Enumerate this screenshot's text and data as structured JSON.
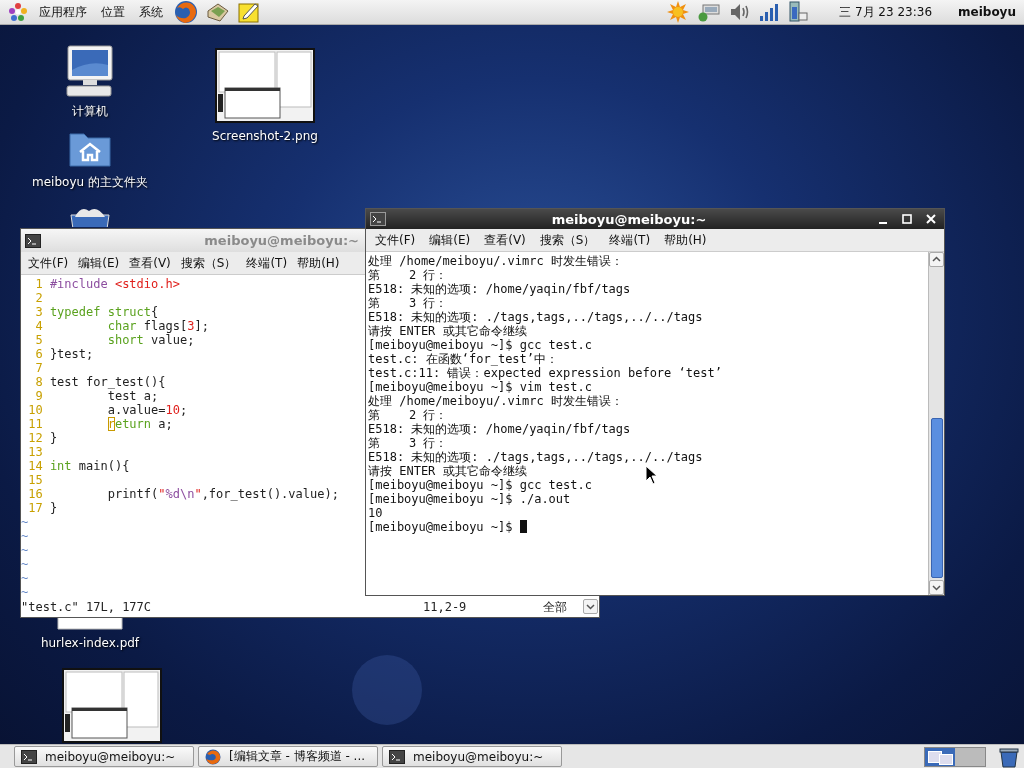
{
  "top_panel": {
    "menus": [
      "应用程序",
      "位置",
      "系统"
    ],
    "clock": "三 7月 23 23:36",
    "user": "meiboyu"
  },
  "desktop_icons": [
    {
      "kind": "computer",
      "label": "计算机"
    },
    {
      "kind": "home-folder",
      "label": "meiboyu 的主文件夹"
    },
    {
      "kind": "trash"
    },
    {
      "kind": "image",
      "label": "Screenshot-2.png"
    },
    {
      "kind": "pdf",
      "label": "hurlex-index.pdf"
    },
    {
      "kind": "image"
    }
  ],
  "editor_window": {
    "title": "meiboyu@meiboyu:~",
    "menus": [
      "文件(F)",
      "编辑(E)",
      "查看(V)",
      "搜索（S）",
      "终端(T)",
      "帮助(H)"
    ],
    "lines": [
      {
        "number": "1",
        "segments": [
          {
            "text": "#include ",
            "kind": "preproc"
          },
          {
            "text": "<stdio.h>",
            "kind": "string"
          }
        ]
      },
      {
        "number": "2"
      },
      {
        "number": "3",
        "segments": [
          {
            "text": "typedef struct",
            "kind": "type"
          },
          {
            "text": "{",
            "kind": "plain"
          }
        ]
      },
      {
        "number": "4",
        "indented": true,
        "segments": [
          {
            "text": "char",
            "kind": "type"
          },
          {
            "text": " flags[",
            "kind": "plain"
          },
          {
            "text": "3",
            "kind": "number"
          },
          {
            "text": "];",
            "kind": "plain"
          }
        ]
      },
      {
        "number": "5",
        "indented": true,
        "segments": [
          {
            "text": "short",
            "kind": "type"
          },
          {
            "text": " value;",
            "kind": "plain"
          }
        ]
      },
      {
        "number": "6",
        "segments": [
          {
            "text": "}test;",
            "kind": "plain"
          }
        ]
      },
      {
        "number": "7"
      },
      {
        "number": "8",
        "segments": [
          {
            "text": "test for_test(){",
            "kind": "plain"
          }
        ]
      },
      {
        "number": "9",
        "indented": true,
        "segments": [
          {
            "text": "test a;",
            "kind": "plain"
          }
        ]
      },
      {
        "number": "10",
        "indented": true,
        "segments": [
          {
            "text": "a.value=",
            "kind": "plain"
          },
          {
            "text": "10",
            "kind": "number"
          },
          {
            "text": ";",
            "kind": "plain"
          }
        ]
      },
      {
        "number": "11",
        "indented": true,
        "segments": [
          {
            "text": "r",
            "kind": "cursor"
          },
          {
            "text": "eturn",
            "kind": "type"
          },
          {
            "text": " a;",
            "kind": "plain"
          }
        ]
      },
      {
        "number": "12",
        "segments": [
          {
            "text": "}",
            "kind": "plain"
          }
        ]
      },
      {
        "number": "13"
      },
      {
        "number": "14",
        "segments": [
          {
            "text": "int",
            "kind": "type"
          },
          {
            "text": " main(){",
            "kind": "plain"
          }
        ]
      },
      {
        "number": "15"
      },
      {
        "number": "16",
        "indented": true,
        "segments": [
          {
            "text": "printf(",
            "kind": "plain"
          },
          {
            "text": "\"",
            "kind": "string"
          },
          {
            "text": "%d\\n",
            "kind": "preproc"
          },
          {
            "text": "\"",
            "kind": "string"
          },
          {
            "text": ",for_test().value);",
            "kind": "plain"
          }
        ]
      },
      {
        "number": "17",
        "segments": [
          {
            "text": "}",
            "kind": "plain"
          }
        ]
      }
    ],
    "filler_lines": [
      "~",
      "~",
      "~",
      "~",
      "~",
      "~"
    ],
    "status": "\"test.c\" 17L, 177C",
    "position": "11,2-9",
    "scroll": "全部"
  },
  "terminal_window": {
    "title": "meiboyu@meiboyu:~",
    "menus": [
      "文件(F)",
      "编辑(E)",
      "查看(V)",
      "搜索（S）",
      "终端(T)",
      "帮助(H)"
    ],
    "lines": [
      "处理 /home/meiboyu/.vimrc 时发生错误：",
      "第    2 行：",
      "E518: 未知的选项: /home/yaqin/fbf/tags",
      "第    3 行：",
      "E518: 未知的选项: ./tags,tags,../tags,../../tags",
      "请按 ENTER 或其它命令继续",
      "[meiboyu@meiboyu ~]$ gcc test.c",
      "test.c: 在函数‘for_test’中：",
      "test.c:11: 错误：expected expression before ‘test’",
      "[meiboyu@meiboyu ~]$ vim test.c",
      "处理 /home/meiboyu/.vimrc 时发生错误：",
      "第    2 行：",
      "E518: 未知的选项: /home/yaqin/fbf/tags",
      "第    3 行：",
      "E518: 未知的选项: ./tags,tags,../tags,../../tags",
      "请按 ENTER 或其它命令继续",
      "[meiboyu@meiboyu ~]$ gcc test.c",
      "[meiboyu@meiboyu ~]$ ./a.out",
      "10",
      "[meiboyu@meiboyu ~]$"
    ]
  },
  "taskbar": {
    "tasks": [
      {
        "kind": "terminal",
        "label": "meiboyu@meiboyu:~"
      },
      {
        "kind": "browser",
        "label": "[编辑文章 - 博客频道 - ..."
      },
      {
        "kind": "terminal",
        "label": "meiboyu@meiboyu:~"
      }
    ],
    "workspaces": [
      {
        "selected": true
      },
      {
        "selected": false
      }
    ]
  }
}
